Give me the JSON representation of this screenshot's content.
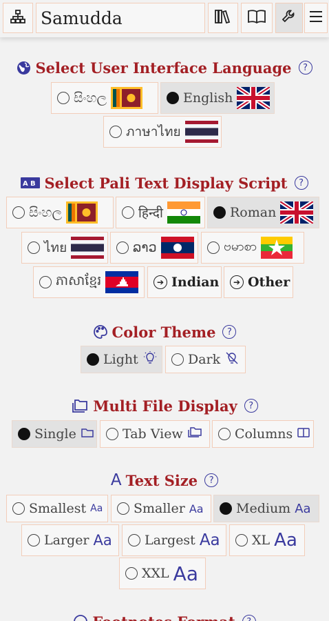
{
  "topbar": {
    "title": "Samudda",
    "icons": [
      "sitemap-icon",
      "library-icon",
      "book-icon",
      "wrench-icon",
      "menu-icon"
    ]
  },
  "colors": {
    "heading": "#a31f24",
    "accent": "#3a3a9e",
    "border": "#f2cdb9",
    "selected_bg": "#e2e2e2"
  },
  "ui_language": {
    "title": "Select User Interface Language",
    "help": "?",
    "options": [
      {
        "label": "සිංහල",
        "flag": "sri-lanka"
      },
      {
        "label": "English",
        "flag": "uk",
        "selected": true
      },
      {
        "label": "ภาษาไทย",
        "flag": "thailand"
      }
    ]
  },
  "pali_script": {
    "title": "Select Pali Text Display Script",
    "help": "?",
    "options": [
      {
        "label": "සිංහල",
        "flag": "sri-lanka"
      },
      {
        "label": "हिन्दी",
        "flag": "india"
      },
      {
        "label": "Roman",
        "flag": "uk",
        "selected": true
      },
      {
        "label": "ไทย",
        "flag": "thailand"
      },
      {
        "label": "ລາວ",
        "flag": "laos"
      },
      {
        "label": "ဗမာစာ",
        "flag": "myanmar"
      },
      {
        "label": "ភាសាខ្មែរ",
        "flag": "cambodia"
      },
      {
        "label": "Indian"
      },
      {
        "label": "Other"
      }
    ]
  },
  "color_theme": {
    "title": "Color Theme",
    "help": "?",
    "options": [
      {
        "label": "Light",
        "icon": "bulb-on-icon",
        "selected": true
      },
      {
        "label": "Dark",
        "icon": "bulb-off-icon"
      }
    ]
  },
  "multi_file": {
    "title": "Multi File Display",
    "help": "?",
    "options": [
      {
        "label": "Single",
        "icon": "folder-icon",
        "selected": true
      },
      {
        "label": "Tab View",
        "icon": "folders-icon"
      },
      {
        "label": "Columns",
        "icon": "columns-icon"
      }
    ]
  },
  "text_size": {
    "title": "Text Size",
    "help": "?",
    "options": [
      {
        "label": "Smallest",
        "sample": "Aa"
      },
      {
        "label": "Smaller",
        "sample": "Aa"
      },
      {
        "label": "Medium",
        "sample": "Aa",
        "selected": true
      },
      {
        "label": "Larger",
        "sample": "Aa"
      },
      {
        "label": "Largest",
        "sample": "Aa"
      },
      {
        "label": "XL",
        "sample": "Aa"
      },
      {
        "label": "XXL",
        "sample": "Aa"
      }
    ]
  },
  "footnotes": {
    "title": "Footnotes Format",
    "help": "?"
  }
}
